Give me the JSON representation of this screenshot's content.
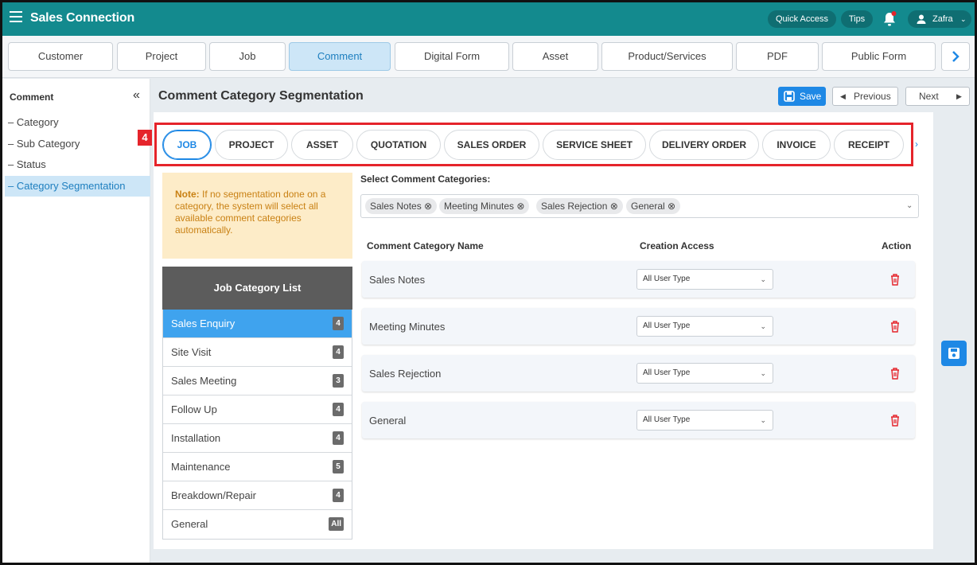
{
  "header": {
    "app_title": "Sales Connection",
    "quick_access": "Quick Access",
    "tips": "Tips",
    "user_name": "Zafra",
    "brand_color": "#138a8e"
  },
  "module_tabs": [
    "Customer",
    "Project",
    "Job",
    "Comment",
    "Digital Form",
    "Asset",
    "Product/Services",
    "PDF",
    "Public Form"
  ],
  "module_active": "Comment",
  "sidebar": {
    "title": "Comment",
    "items": [
      "– Category",
      "– Sub Category",
      "– Status",
      "– Category Segmentation"
    ],
    "active": "– Category Segmentation"
  },
  "page": {
    "title": "Comment Category Segmentation",
    "save": "Save",
    "previous": "Previous",
    "next": "Next"
  },
  "step_badge": "4",
  "segment_tabs": [
    "JOB",
    "PROJECT",
    "ASSET",
    "QUOTATION",
    "SALES ORDER",
    "SERVICE SHEET",
    "DELIVERY ORDER",
    "INVOICE",
    "RECEIPT"
  ],
  "segment_active": "JOB",
  "note": {
    "label": "Note:",
    "text": " If no segmentation done on a category, the system will select all available comment categories automatically."
  },
  "category_list": {
    "header": "Job Category List",
    "items": [
      {
        "name": "Sales Enquiry",
        "count": "4"
      },
      {
        "name": "Site Visit",
        "count": "4"
      },
      {
        "name": "Sales Meeting",
        "count": "3"
      },
      {
        "name": "Follow Up",
        "count": "4"
      },
      {
        "name": "Installation",
        "count": "4"
      },
      {
        "name": "Maintenance",
        "count": "5"
      },
      {
        "name": "Breakdown/Repair",
        "count": "4"
      },
      {
        "name": "General",
        "count": "All"
      }
    ],
    "active": "Sales Enquiry"
  },
  "selector": {
    "label": "Select Comment Categories:",
    "chips": [
      "Sales Notes ⊗",
      "Meeting Minutes ⊗",
      "Sales Rejection ⊗",
      "General ⊗"
    ]
  },
  "table": {
    "col_name": "Comment Category Name",
    "col_access": "Creation Access",
    "col_action": "Action",
    "rows": [
      {
        "name": "Sales Notes",
        "access": "All User Type"
      },
      {
        "name": "Meeting Minutes",
        "access": "All User Type"
      },
      {
        "name": "Sales Rejection",
        "access": "All User Type"
      },
      {
        "name": "General",
        "access": "All User Type"
      }
    ]
  },
  "icons": [
    "menu-icon",
    "bell-icon",
    "user-icon",
    "chevron-down-icon",
    "chevron-right-icon",
    "collapse-icon",
    "save-icon",
    "triangle-left-icon",
    "triangle-right-icon",
    "trash-icon"
  ],
  "colors": {
    "accent": "#1e88e5",
    "highlight": "#e5242b",
    "active_list": "#3fa3ee",
    "note_bg": "#fdecc8"
  }
}
